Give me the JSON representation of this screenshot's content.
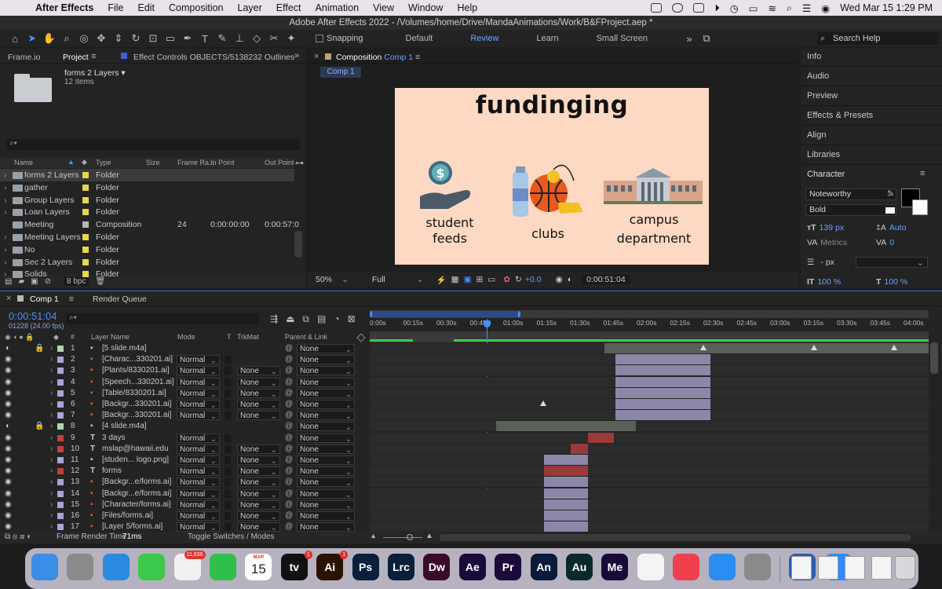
{
  "menubar": {
    "app": "After Effects",
    "items": [
      "File",
      "Edit",
      "Composition",
      "Layer",
      "Effect",
      "Animation",
      "View",
      "Window",
      "Help"
    ],
    "datetime": "Wed Mar 15  1:29 PM"
  },
  "window_title": "Adobe After Effects 2022 - /Volumes/home/Drive/MandaAnimations/Work/B&FProject.aep *",
  "toolbar": {
    "snapping": "Snapping",
    "workspaces": [
      "Default",
      "Review",
      "Learn",
      "Small Screen"
    ],
    "search_help": "Search Help"
  },
  "project_panel": {
    "tabs": [
      "Frame.io",
      "Project"
    ],
    "effect_controls_tab": "Effect Controls OBJECTS/5138232 Outlines",
    "selected_name": "forms 2 Layers",
    "item_count": "12 items",
    "columns": [
      "Name",
      "Type",
      "Size",
      "Frame Ra...",
      "In Point",
      "Out Point"
    ],
    "rows": [
      {
        "name": "forms 2 Layers",
        "type": "Folder",
        "color": "#e6d84a",
        "fps": "",
        "in": "",
        "out": ""
      },
      {
        "name": "gather",
        "type": "Folder",
        "color": "#e6d84a",
        "fps": "",
        "in": "",
        "out": ""
      },
      {
        "name": "Group Layers",
        "type": "Folder",
        "color": "#e6d84a",
        "fps": "",
        "in": "",
        "out": ""
      },
      {
        "name": "Loan Layers",
        "type": "Folder",
        "color": "#e6d84a",
        "fps": "",
        "in": "",
        "out": ""
      },
      {
        "name": "Meeting",
        "type": "Composition",
        "color": "#b7b7b7",
        "fps": "24",
        "in": "0:00:00:00",
        "out": "0:00:57:0"
      },
      {
        "name": "Meeting Layers",
        "type": "Folder",
        "color": "#e6d84a",
        "fps": "",
        "in": "",
        "out": ""
      },
      {
        "name": "No",
        "type": "Folder",
        "color": "#e6d84a",
        "fps": "",
        "in": "",
        "out": ""
      },
      {
        "name": "Sec 2 Layers",
        "type": "Folder",
        "color": "#e6d84a",
        "fps": "",
        "in": "",
        "out": ""
      },
      {
        "name": "Solids",
        "type": "Folder",
        "color": "#e6d84a",
        "fps": "",
        "in": "",
        "out": ""
      }
    ],
    "bpc": "8 bpc"
  },
  "composition_panel": {
    "title": "Composition",
    "comp_name": "Comp 1",
    "comp_tab": "Comp 1",
    "zoom": "50%",
    "resolution": "Full",
    "exposure": "+0.0",
    "timecode": "0:00:51:04",
    "canvas": {
      "heading": "fundinging",
      "labels": [
        "student\nfeeds",
        "clubs",
        "campus\ndepartment"
      ]
    }
  },
  "right_panel": {
    "items": [
      "Info",
      "Audio",
      "Preview",
      "Effects & Presets",
      "Align",
      "Libraries"
    ],
    "character": {
      "title": "Character",
      "font": "Noteworthy",
      "style": "Bold",
      "size": "139 px",
      "leading": "Auto",
      "kerning": "Metrics",
      "tracking": "0",
      "stroke": "- px",
      "vscale": "100 %",
      "hscale": "100 %"
    }
  },
  "timeline": {
    "tabs": [
      "Comp 1",
      "Render Queue"
    ],
    "timecode": "0:00:51:04",
    "frames": "01228 (24.00 fps)",
    "columns": [
      "#",
      "Layer Name",
      "Mode",
      "T",
      "TrkMat",
      "Parent & Link"
    ],
    "ruler": [
      "0:00s",
      "00:15s",
      "00:30s",
      "00:45s",
      "01:00s",
      "01:15s",
      "01:30s",
      "01:45s",
      "02:00s",
      "02:15s",
      "02:30s",
      "02:45s",
      "03:00s",
      "03:15s",
      "03:30s",
      "03:45s",
      "04:00s"
    ],
    "layers": [
      {
        "num": "1",
        "name": "[5 slide.m4a]",
        "mode": "",
        "trk": "",
        "parent": "None",
        "color": "#a8d8b0",
        "kind": "audio"
      },
      {
        "num": "2",
        "name": "[Charac...330201.ai]",
        "mode": "Normal",
        "trk": "",
        "parent": "None",
        "color": "#a7a6d6",
        "kind": "ai"
      },
      {
        "num": "3",
        "name": "[Plants/8330201.ai]",
        "mode": "Normal",
        "trk": "None",
        "parent": "None",
        "color": "#a7a6d6",
        "kind": "ai"
      },
      {
        "num": "4",
        "name": "[Speech...330201.ai]",
        "mode": "Normal",
        "trk": "None",
        "parent": "None",
        "color": "#a7a6d6",
        "kind": "ai"
      },
      {
        "num": "5",
        "name": "[Table/8330201.ai]",
        "mode": "Normal",
        "trk": "None",
        "parent": "None",
        "color": "#a7a6d6",
        "kind": "ai"
      },
      {
        "num": "6",
        "name": "[Backgr...330201.ai]",
        "mode": "Normal",
        "trk": "None",
        "parent": "None",
        "color": "#a7a6d6",
        "kind": "ai"
      },
      {
        "num": "7",
        "name": "[Backgr...330201.ai]",
        "mode": "Normal",
        "trk": "None",
        "parent": "None",
        "color": "#a7a6d6",
        "kind": "ai"
      },
      {
        "num": "8",
        "name": "[4 slide.m4a]",
        "mode": "",
        "trk": "",
        "parent": "None",
        "color": "#a8d8b0",
        "kind": "audio"
      },
      {
        "num": "9",
        "name": "3 days",
        "mode": "Normal",
        "trk": "",
        "parent": "None",
        "color": "#c04040",
        "kind": "text"
      },
      {
        "num": "10",
        "name": "mslap@hawaii.edu",
        "mode": "Normal",
        "trk": "None",
        "parent": "None",
        "color": "#c04040",
        "kind": "text"
      },
      {
        "num": "11",
        "name": "[studen... logo.png]",
        "mode": "Normal",
        "trk": "None",
        "parent": "None",
        "color": "#a7a6d6",
        "kind": "png"
      },
      {
        "num": "12",
        "name": "forms",
        "mode": "Normal",
        "trk": "None",
        "parent": "None",
        "color": "#c04040",
        "kind": "text"
      },
      {
        "num": "13",
        "name": "[Backgr...e/forms.ai]",
        "mode": "Normal",
        "trk": "None",
        "parent": "None",
        "color": "#a7a6d6",
        "kind": "ai"
      },
      {
        "num": "14",
        "name": "[Backgr...e/forms.ai]",
        "mode": "Normal",
        "trk": "None",
        "parent": "None",
        "color": "#a7a6d6",
        "kind": "ai"
      },
      {
        "num": "15",
        "name": "[Character/forms.ai]",
        "mode": "Normal",
        "trk": "None",
        "parent": "None",
        "color": "#a7a6d6",
        "kind": "ai"
      },
      {
        "num": "16",
        "name": "[Files/forms.ai]",
        "mode": "Normal",
        "trk": "None",
        "parent": "None",
        "color": "#a7a6d6",
        "kind": "ai"
      },
      {
        "num": "17",
        "name": "[Layer 5/forms.ai]",
        "mode": "Normal",
        "trk": "None",
        "parent": "None",
        "color": "#a7a6d6",
        "kind": "ai"
      }
    ],
    "footer": {
      "render_label": "Frame Render Time",
      "render_time": "71ms",
      "toggle": "Toggle Switches / Modes"
    }
  },
  "dock": {
    "apps": [
      {
        "name": "Finder",
        "label": "",
        "color": "#3a8ee6"
      },
      {
        "name": "Launchpad",
        "label": "",
        "color": "#8a8a8a"
      },
      {
        "name": "Safari",
        "label": "",
        "color": "#2a8ae0"
      },
      {
        "name": "Messages",
        "label": "",
        "color": "#3cc84a"
      },
      {
        "name": "Photos",
        "label": "",
        "color": "#f0f0f0",
        "badge": "11,636"
      },
      {
        "name": "FaceTime",
        "label": "",
        "color": "#2fbf4a"
      },
      {
        "name": "Calendar",
        "label": "15",
        "color": "#ffffff",
        "sub": "MAR"
      },
      {
        "name": "TV",
        "label": "tv",
        "color": "#111111",
        "badge": "1"
      },
      {
        "name": "Illustrator",
        "label": "Ai",
        "color": "#2b1200",
        "badge": "1"
      },
      {
        "name": "Photoshop",
        "label": "Ps",
        "color": "#0a1f3a"
      },
      {
        "name": "Lightroom Classic",
        "label": "Lrc",
        "color": "#0a1f3a"
      },
      {
        "name": "Dreamweaver",
        "label": "Dw",
        "color": "#3a0a2a"
      },
      {
        "name": "After Effects",
        "label": "Ae",
        "color": "#1a0a3a"
      },
      {
        "name": "Premiere Pro",
        "label": "Pr",
        "color": "#1a0a3a"
      },
      {
        "name": "Animate",
        "label": "An",
        "color": "#0a1a3a"
      },
      {
        "name": "Audition",
        "label": "Au",
        "color": "#0a2a2a"
      },
      {
        "name": "Media Encoder",
        "label": "Me",
        "color": "#1a0a3a"
      },
      {
        "name": "Chrome",
        "label": "",
        "color": "#f4f4f4"
      },
      {
        "name": "Music",
        "label": "",
        "color": "#f04050"
      },
      {
        "name": "App Store",
        "label": "",
        "color": "#2a8ef0"
      },
      {
        "name": "System Preferences",
        "label": "",
        "color": "#8a8a8a"
      },
      {
        "name": "Word",
        "label": "W",
        "color": "#2b5cb4"
      },
      {
        "name": "Zoom",
        "label": "",
        "color": "#2d8cff"
      }
    ]
  },
  "colors": {
    "accent": "#4a8fff",
    "time_indicator": "#4a8fff",
    "work_area": "#3a6fd0"
  }
}
